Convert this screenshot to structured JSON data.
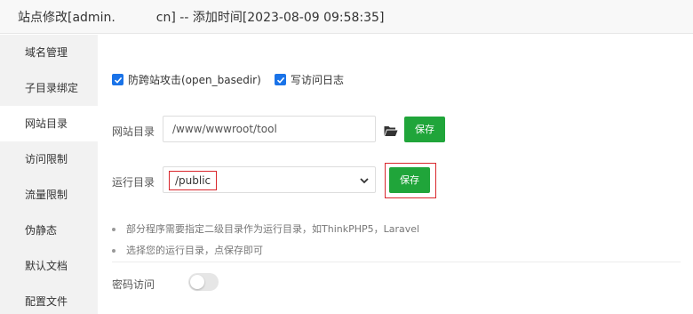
{
  "title": {
    "prefix": "站点修改[admin.",
    "suffix": "cn] -- 添加时间[2023-08-09 09:58:35]"
  },
  "sidebar": {
    "items": [
      {
        "label": "域名管理",
        "active": false
      },
      {
        "label": "子目录绑定",
        "active": false
      },
      {
        "label": "网站目录",
        "active": true
      },
      {
        "label": "访问限制",
        "active": false
      },
      {
        "label": "流量限制",
        "active": false
      },
      {
        "label": "伪静态",
        "active": false
      },
      {
        "label": "默认文档",
        "active": false
      },
      {
        "label": "配置文件",
        "active": false
      }
    ]
  },
  "options": {
    "open_basedir": {
      "label": "防跨站攻击(open_basedir)",
      "checked": true
    },
    "access_log": {
      "label": "写访问日志",
      "checked": true
    }
  },
  "site_dir": {
    "label": "网站目录",
    "value": "/www/wwwroot/tool",
    "save_label": "保存"
  },
  "run_dir": {
    "label": "运行目录",
    "selected": "/public",
    "save_label": "保存"
  },
  "tips": [
    "部分程序需要指定二级目录作为运行目录，如ThinkPHP5，Laravel",
    "选择您的运行目录，点保存即可"
  ],
  "password_access": {
    "label": "密码访问",
    "enabled": false
  },
  "colors": {
    "accent_green": "#20a53a",
    "checkbox_blue": "#1a73e8",
    "highlight_red": "#d9262c"
  },
  "icons": {
    "folder": "folder-open-icon",
    "checkmark": "checkmark-icon",
    "dropdown": "chevron-down-icon"
  }
}
